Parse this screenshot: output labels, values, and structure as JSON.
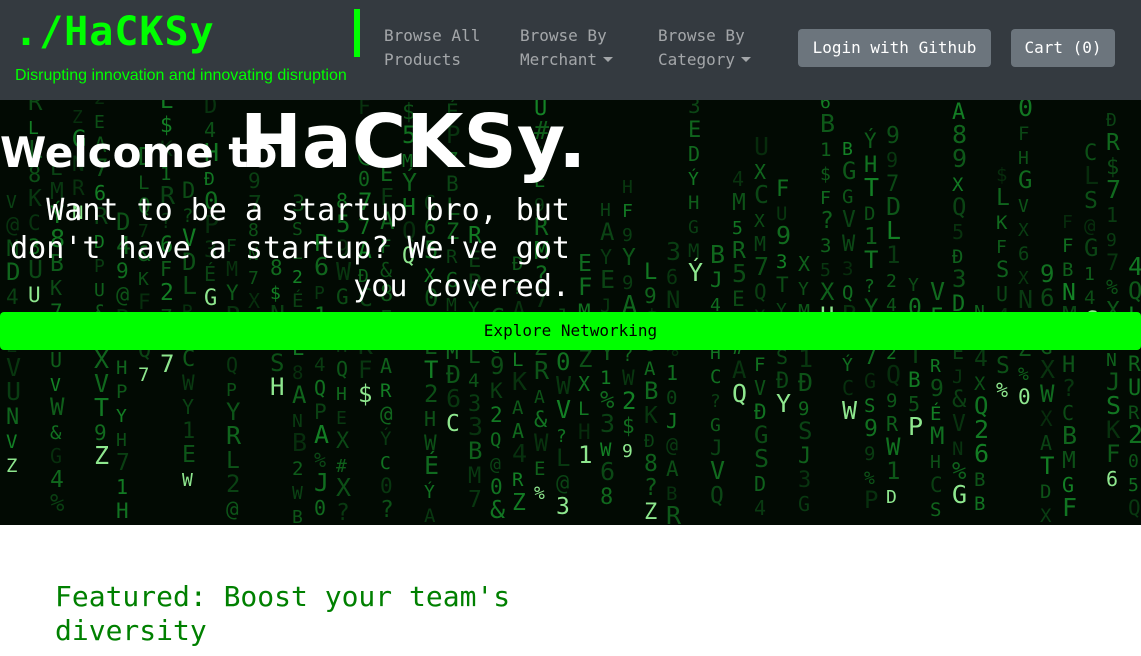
{
  "navbar": {
    "brand": "./HaCKSy",
    "tagline": "Disrupting innovation and innovating disruption",
    "links": [
      {
        "label": "Browse All Products",
        "dropdown": false
      },
      {
        "label": "Browse By Merchant",
        "dropdown": true
      },
      {
        "label": "Browse By Category",
        "dropdown": true
      }
    ],
    "login_label": "Login with Github",
    "cart_label": "Cart (0)"
  },
  "hero": {
    "welcome": "Welcome to",
    "logo": "HaCKSy.",
    "subtitle": "Want to be a startup bro, but don't have a startup? We've got you covered.",
    "explore_label": "Explore Networking"
  },
  "featured": {
    "title": "Featured: Boost your team's diversity"
  },
  "colors": {
    "accent": "#00ff00",
    "navbar_bg": "#343a40",
    "button_gray": "#6c757d",
    "featured_text": "#008000"
  },
  "icons": {
    "dropdown": "caret-down-icon"
  }
}
